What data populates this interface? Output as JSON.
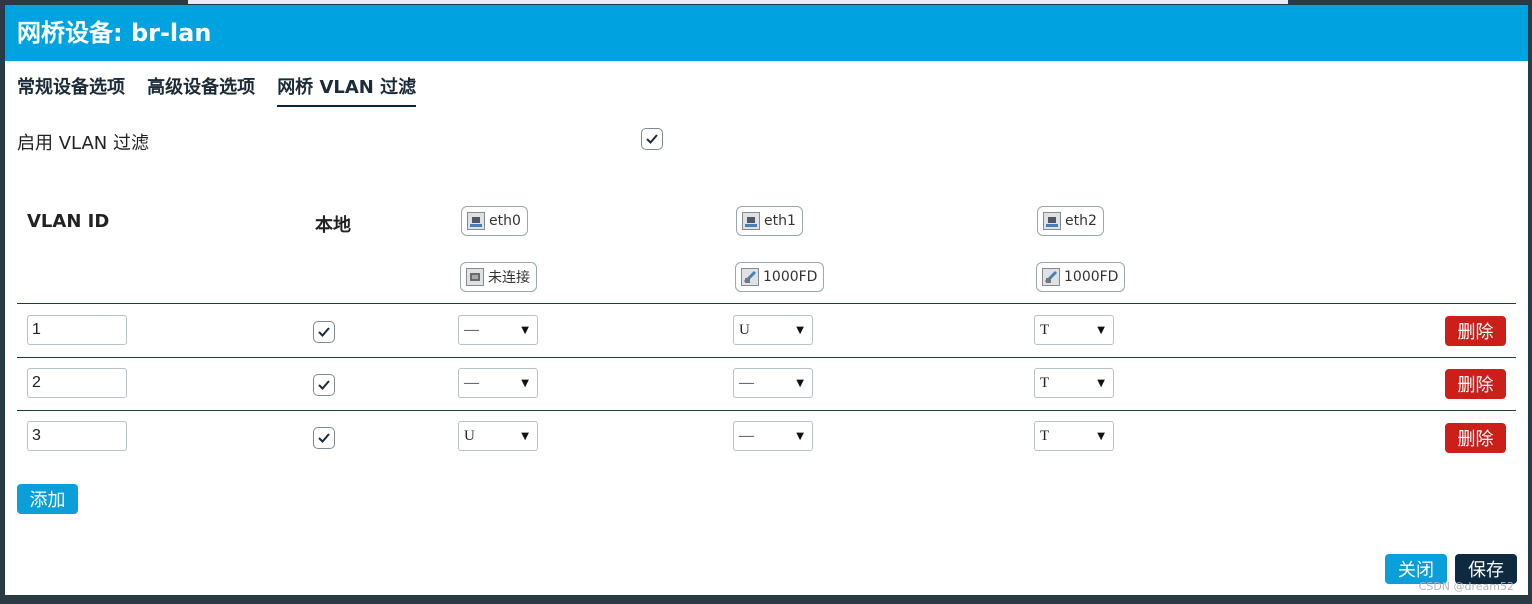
{
  "modal": {
    "title": "网桥设备: br-lan"
  },
  "tabs": [
    {
      "label": "常规设备选项"
    },
    {
      "label": "高级设备选项"
    },
    {
      "label": "网桥 VLAN 过滤",
      "active": true
    }
  ],
  "enable_vlan": {
    "label": "启用 VLAN 过滤",
    "checked": true
  },
  "table": {
    "headers": {
      "vlan_id": "VLAN ID",
      "local": "本地"
    },
    "ports": [
      {
        "name": "eth0",
        "status": "未连接"
      },
      {
        "name": "eth1",
        "status": "1000FD"
      },
      {
        "name": "eth2",
        "status": "1000FD"
      }
    ],
    "rows": [
      {
        "id": "1",
        "local": true,
        "eth0": "—",
        "eth1": "U",
        "eth2": "T",
        "delete_label": "删除"
      },
      {
        "id": "2",
        "local": true,
        "eth0": "—",
        "eth1": "—",
        "eth2": "T",
        "delete_label": "删除"
      },
      {
        "id": "3",
        "local": true,
        "eth0": "U",
        "eth1": "—",
        "eth2": "T",
        "delete_label": "删除"
      }
    ]
  },
  "buttons": {
    "add": "添加",
    "close": "关闭",
    "save": "保存"
  },
  "watermark": "CSDN @dream52",
  "colors": {
    "header": "#00a3e0",
    "delete": "#cc1f1a",
    "primary": "#0a9fd8",
    "save": "#0d2a40"
  }
}
